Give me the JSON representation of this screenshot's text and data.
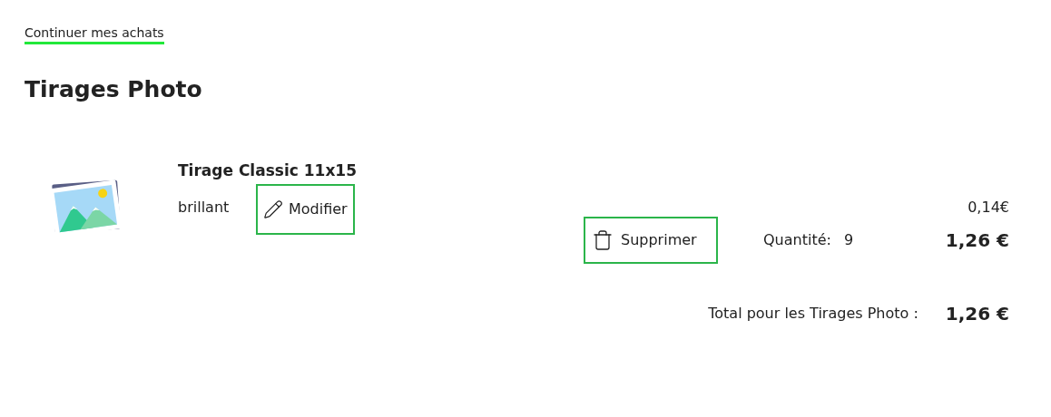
{
  "back_link": "Continuer mes achats",
  "section_title": "Tirages Photo",
  "item": {
    "name": "Tirage Classic 11x15",
    "finish": "brillant",
    "edit_button": "Modifier",
    "delete_button": "Supprimer",
    "unit_price": "0,14€",
    "quantity_label": "Quantité:",
    "quantity": "9",
    "line_total": "1,26 €"
  },
  "total": {
    "label": "Total pour les Tirages Photo :",
    "value": "1,26 €"
  }
}
